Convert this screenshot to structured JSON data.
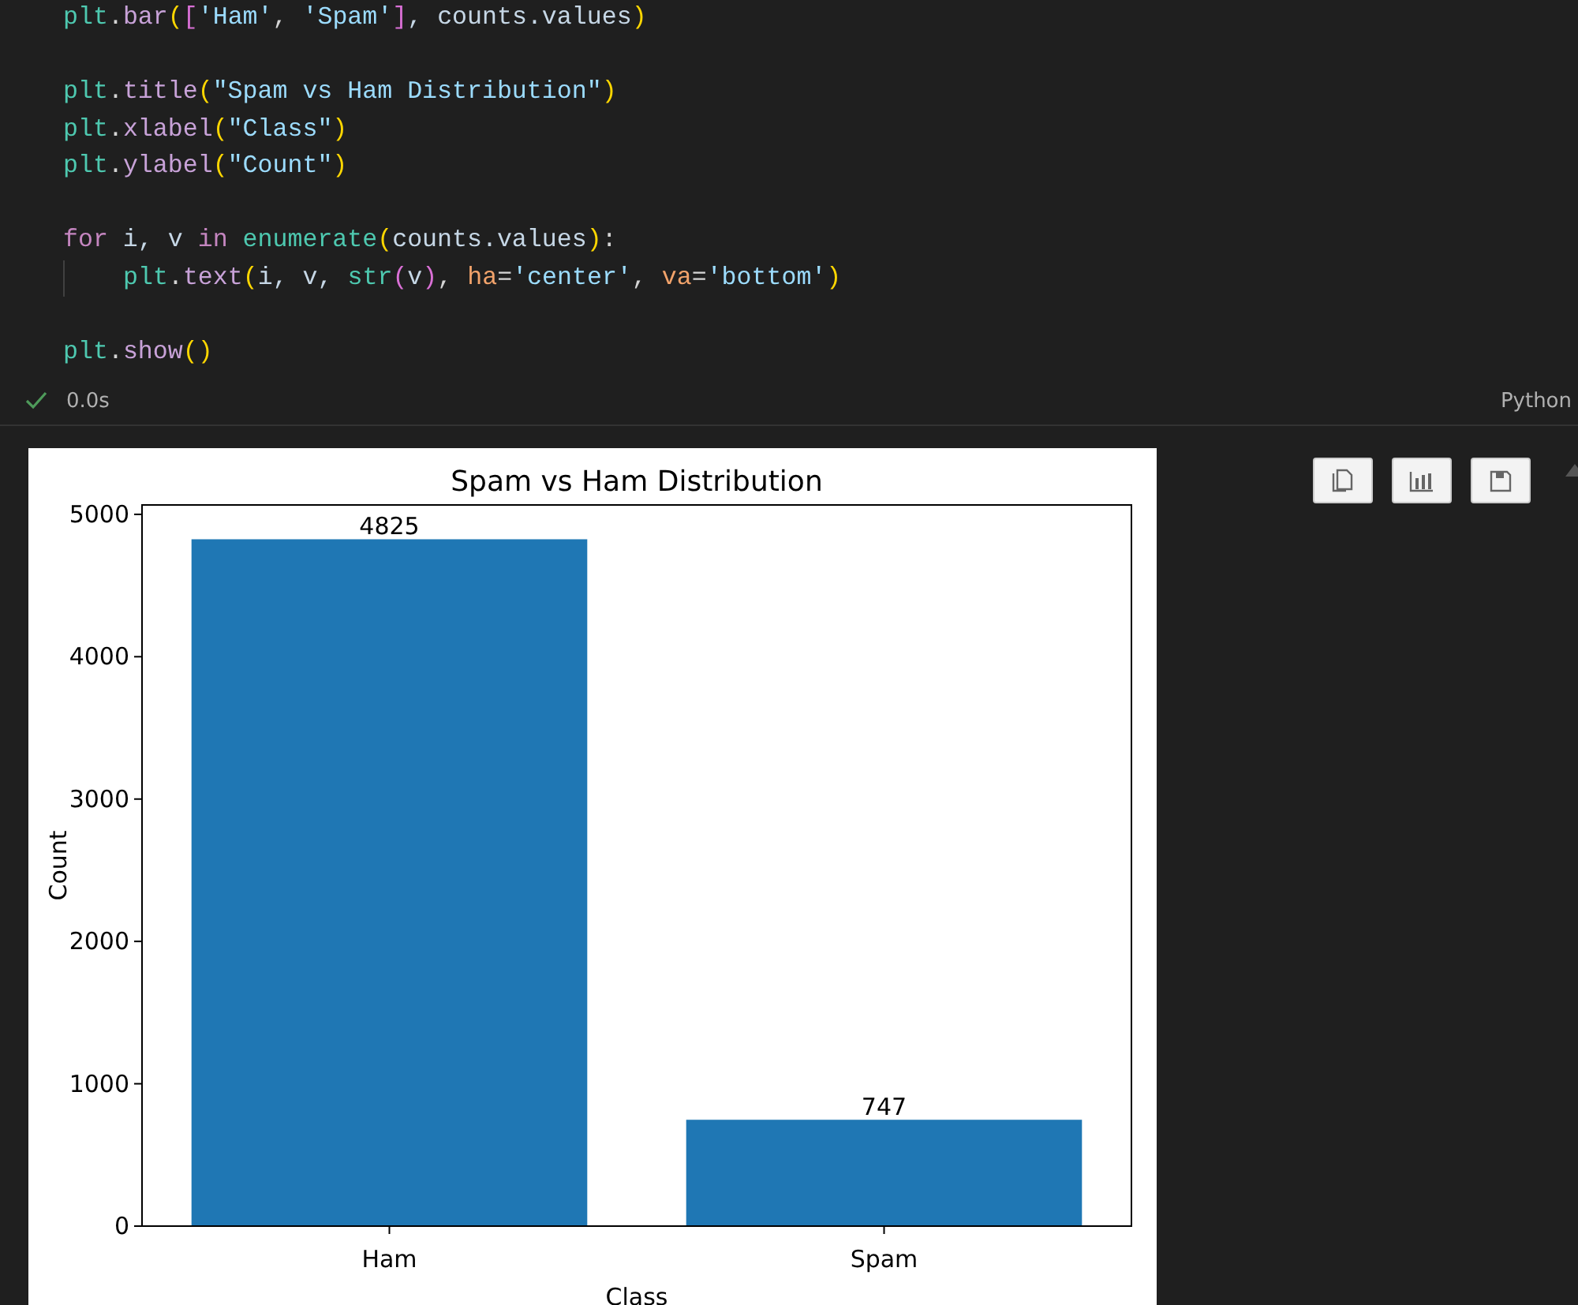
{
  "code": {
    "blocks": [
      {
        "lines": [
          {
            "indent": false,
            "tokens": [
              {
                "text": "plt",
                "kind": "module"
              },
              {
                "text": ".",
                "kind": "plain"
              },
              {
                "text": "bar",
                "kind": "method"
              },
              {
                "text": "(",
                "kind": "bracket1"
              },
              {
                "text": "[",
                "kind": "bracket2"
              },
              {
                "text": "'Ham'",
                "kind": "string"
              },
              {
                "text": ", ",
                "kind": "plain"
              },
              {
                "text": "'Spam'",
                "kind": "string"
              },
              {
                "text": "]",
                "kind": "bracket2"
              },
              {
                "text": ", counts.values",
                "kind": "variable"
              },
              {
                "text": ")",
                "kind": "bracket1"
              }
            ]
          }
        ]
      },
      {
        "lines": [
          {
            "indent": false,
            "tokens": [
              {
                "text": "plt",
                "kind": "module"
              },
              {
                "text": ".",
                "kind": "plain"
              },
              {
                "text": "title",
                "kind": "method"
              },
              {
                "text": "(",
                "kind": "bracket1"
              },
              {
                "text": "\"Spam vs Ham Distribution\"",
                "kind": "string"
              },
              {
                "text": ")",
                "kind": "bracket1"
              }
            ]
          },
          {
            "indent": false,
            "tokens": [
              {
                "text": "plt",
                "kind": "module"
              },
              {
                "text": ".",
                "kind": "plain"
              },
              {
                "text": "xlabel",
                "kind": "method"
              },
              {
                "text": "(",
                "kind": "bracket1"
              },
              {
                "text": "\"Class\"",
                "kind": "string"
              },
              {
                "text": ")",
                "kind": "bracket1"
              }
            ]
          },
          {
            "indent": false,
            "tokens": [
              {
                "text": "plt",
                "kind": "module"
              },
              {
                "text": ".",
                "kind": "plain"
              },
              {
                "text": "ylabel",
                "kind": "method"
              },
              {
                "text": "(",
                "kind": "bracket1"
              },
              {
                "text": "\"Count\"",
                "kind": "string"
              },
              {
                "text": ")",
                "kind": "bracket1"
              }
            ]
          }
        ]
      },
      {
        "lines": [
          {
            "indent": false,
            "tokens": [
              {
                "text": "for",
                "kind": "keyword"
              },
              {
                "text": " i, v ",
                "kind": "variable"
              },
              {
                "text": "in",
                "kind": "keyword"
              },
              {
                "text": " enumerate",
                "kind": "builtin"
              },
              {
                "text": "(",
                "kind": "bracket1"
              },
              {
                "text": "counts.values",
                "kind": "variable"
              },
              {
                "text": ")",
                "kind": "bracket1"
              },
              {
                "text": ":",
                "kind": "plain"
              }
            ]
          },
          {
            "indent": true,
            "tokens": [
              {
                "text": "plt",
                "kind": "module"
              },
              {
                "text": ".",
                "kind": "plain"
              },
              {
                "text": "text",
                "kind": "method"
              },
              {
                "text": "(",
                "kind": "bracket1"
              },
              {
                "text": "i, v, ",
                "kind": "variable"
              },
              {
                "text": "str",
                "kind": "builtin"
              },
              {
                "text": "(",
                "kind": "bracket2"
              },
              {
                "text": "v",
                "kind": "variable"
              },
              {
                "text": ")",
                "kind": "bracket2"
              },
              {
                "text": ", ",
                "kind": "plain"
              },
              {
                "text": "ha",
                "kind": "param"
              },
              {
                "text": "=",
                "kind": "plain"
              },
              {
                "text": "'center'",
                "kind": "string"
              },
              {
                "text": ", ",
                "kind": "plain"
              },
              {
                "text": "va",
                "kind": "param"
              },
              {
                "text": "=",
                "kind": "plain"
              },
              {
                "text": "'bottom'",
                "kind": "string"
              },
              {
                "text": ")",
                "kind": "bracket1"
              }
            ]
          }
        ]
      },
      {
        "lines": [
          {
            "indent": false,
            "tokens": [
              {
                "text": "plt",
                "kind": "module"
              },
              {
                "text": ".",
                "kind": "plain"
              },
              {
                "text": "show",
                "kind": "method"
              },
              {
                "text": "()",
                "kind": "bracket1"
              }
            ]
          }
        ]
      }
    ]
  },
  "status": {
    "succeeded": true,
    "time": "0.0s",
    "language": "Python"
  },
  "output": {
    "chart_data": {
      "type": "bar",
      "title": "Spam vs Ham Distribution",
      "xlabel": "Class",
      "ylabel": "Count",
      "categories": [
        "Ham",
        "Spam"
      ],
      "series": [
        {
          "color": "#1f77b4",
          "values": [
            4825,
            747
          ]
        }
      ],
      "ylim": [
        0,
        5066
      ],
      "yticks": [
        0,
        1000,
        2000,
        3000,
        4000,
        5000
      ],
      "data_labels": true,
      "value_labels": [
        "4825",
        "747"
      ]
    }
  }
}
